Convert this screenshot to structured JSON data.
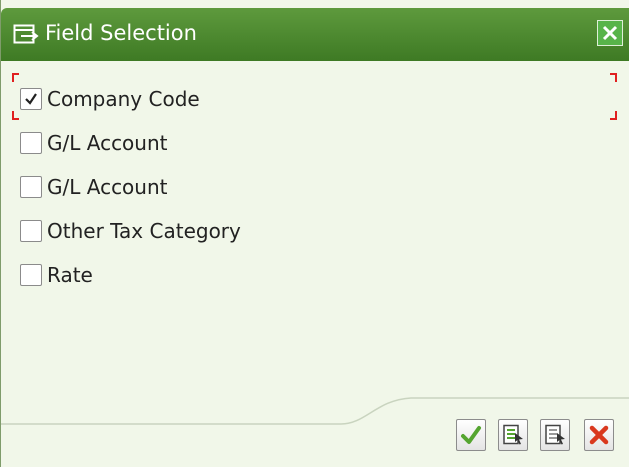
{
  "dialog": {
    "title": "Field Selection",
    "title_icon": "dialog-window-icon",
    "close_icon": "close-icon"
  },
  "fields": [
    {
      "label": "Company Code",
      "checked": true
    },
    {
      "label": "G/L Account",
      "checked": false
    },
    {
      "label": "G/L Account",
      "checked": false
    },
    {
      "label": "Other Tax Category",
      "checked": false
    },
    {
      "label": "Rate",
      "checked": false
    }
  ],
  "toolbar": {
    "buttons": [
      {
        "icon": "checkmark-icon",
        "name": "continue-button"
      },
      {
        "icon": "select-all-icon",
        "name": "select-all-button"
      },
      {
        "icon": "deselect-all-icon",
        "name": "deselect-all-button"
      },
      {
        "icon": "cancel-icon",
        "name": "cancel-button"
      }
    ]
  },
  "colors": {
    "title_bar": "#4a8a2e",
    "background": "#f1f7e9",
    "confirm_green": "#55a530",
    "cancel_red": "#d9381e",
    "focus_red": "#e02020"
  }
}
